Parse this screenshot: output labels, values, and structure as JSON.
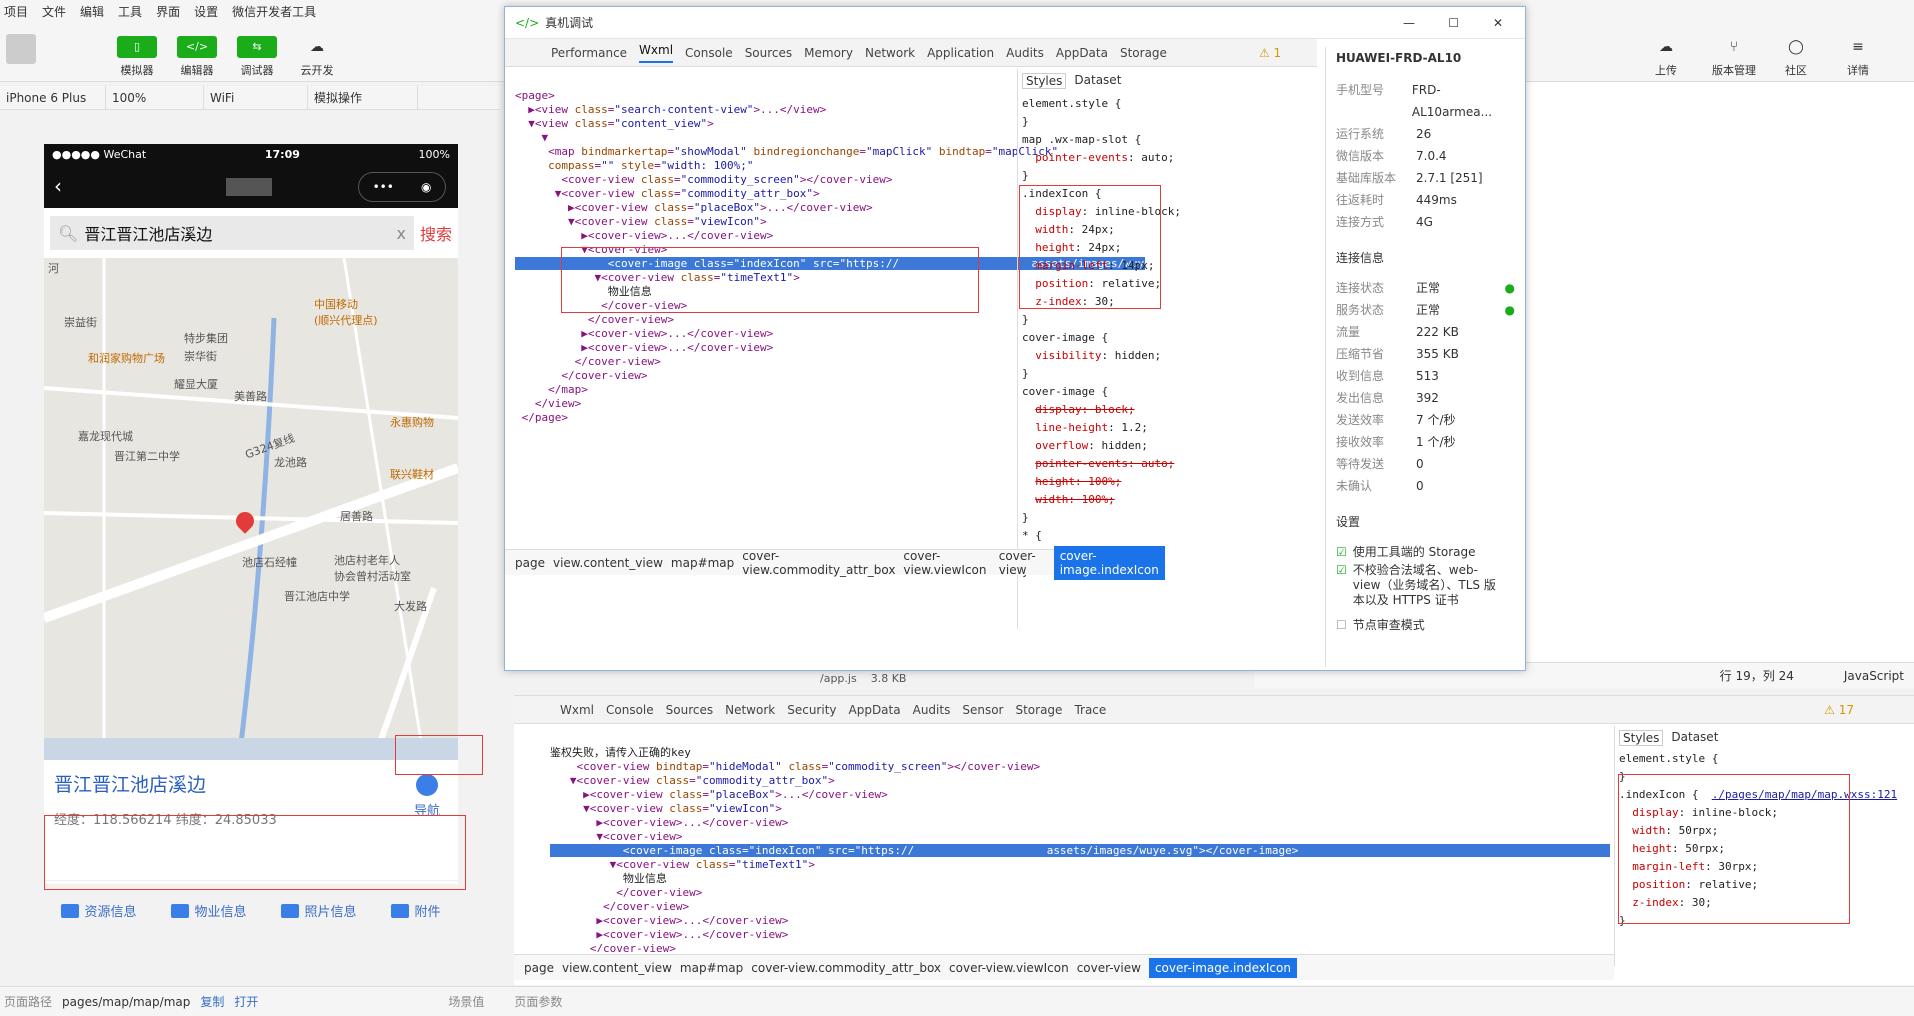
{
  "menu": [
    "项目",
    "文件",
    "编辑",
    "工具",
    "界面",
    "设置",
    "微信开发者工具"
  ],
  "toolbar": {
    "sim": "模拟器",
    "editor": "编辑器",
    "debugger": "调试器",
    "cloud": "云开发",
    "upload": "上传",
    "version": "版本管理",
    "community": "社区",
    "detail": "详情"
  },
  "subbar": {
    "device": "iPhone 6 Plus",
    "zoom": "100%",
    "net": "WiFi",
    "op": "模拟操作"
  },
  "phone": {
    "status_left": "●●●●● WeChat",
    "status_time": "17:09",
    "status_batt": "100%",
    "search_value": "晋江晋江池店溪边",
    "search_btn": "搜索",
    "search_clear": "x",
    "title": "晋江晋江池店溪边",
    "coords": "经度：118.566214   纬度：24.85033",
    "nav": "导航",
    "tabs": [
      "资源信息",
      "物业信息",
      "照片信息",
      "附件"
    ],
    "map_labels": [
      "中国移动\n(顺兴代理点)",
      "特步集团",
      "和润家购物广场",
      "崇益街",
      "崇华街",
      "耀显大厦",
      "美善路",
      "嘉龙现代城",
      "晋江第二中学",
      "龙池路",
      "永惠购物",
      "联兴鞋材",
      "池店石经幢",
      "池店村老年人\n协会曾村活动室",
      "晋江池店中学",
      "G324复线",
      "居善路",
      "大发路",
      "河"
    ]
  },
  "devtools": {
    "title": "真机调试",
    "tabs": [
      "Performance",
      "Wxml",
      "Console",
      "Sources",
      "Memory",
      "Network",
      "Application",
      "Audits",
      "AppData",
      "Storage"
    ],
    "warn": "⚠ 1",
    "crumbs": [
      "page",
      "view.content_view",
      "map#map",
      "cover-view.commodity_attr_box",
      "cover-view.viewIcon",
      "cover-view",
      "cover-image.indexIcon"
    ],
    "styles_tab": "Styles",
    "dataset_tab": "Dataset"
  },
  "device": {
    "name": "HUAWEI-FRD-AL10",
    "rows": [
      [
        "手机型号",
        "FRD-AL10armea..."
      ],
      [
        "运行系统",
        "26"
      ],
      [
        "微信版本",
        "7.0.4"
      ],
      [
        "基础库版本",
        "2.7.1 [251]"
      ],
      [
        "往返耗时",
        "449ms"
      ],
      [
        "连接方式",
        "4G"
      ]
    ],
    "conn_title": "连接信息",
    "conn": [
      [
        "连接状态",
        "正常"
      ],
      [
        "服务状态",
        "正常"
      ],
      [
        "流量",
        "222 KB"
      ],
      [
        "压缩节省",
        "355 KB"
      ],
      [
        "收到信息",
        "513"
      ],
      [
        "发出信息",
        "392"
      ],
      [
        "发送效率",
        "7 个/秒"
      ],
      [
        "接收效率",
        "1 个/秒"
      ],
      [
        "等待发送",
        "0"
      ],
      [
        "未确认",
        "0"
      ]
    ],
    "settings_title": "设置",
    "s1": "使用工具端的 Storage",
    "s2": "不校验合法域名、web-view（业务域名）、TLS 版本以及 HTTPS 证书",
    "s3": "节点审查模式"
  },
  "lower": {
    "tabs": [
      "Wxml",
      "Console",
      "Sources",
      "Network",
      "Security",
      "AppData",
      "Audits",
      "Sensor",
      "Storage",
      "Trace"
    ],
    "warn": "⚠ 17",
    "fail": "鉴权失败，请传入正确的key",
    "file": "/app.js",
    "size": "3.8 KB",
    "pos": "行 19，列 24",
    "lang": "JavaScript",
    "style_link": "./pages/map/map/map.wxss:121"
  },
  "bottom": {
    "path_label": "页面路径",
    "path": "pages/map/map/map",
    "copy": "复制",
    "open": "打开",
    "scene": "场景值",
    "params": "页面参数"
  }
}
